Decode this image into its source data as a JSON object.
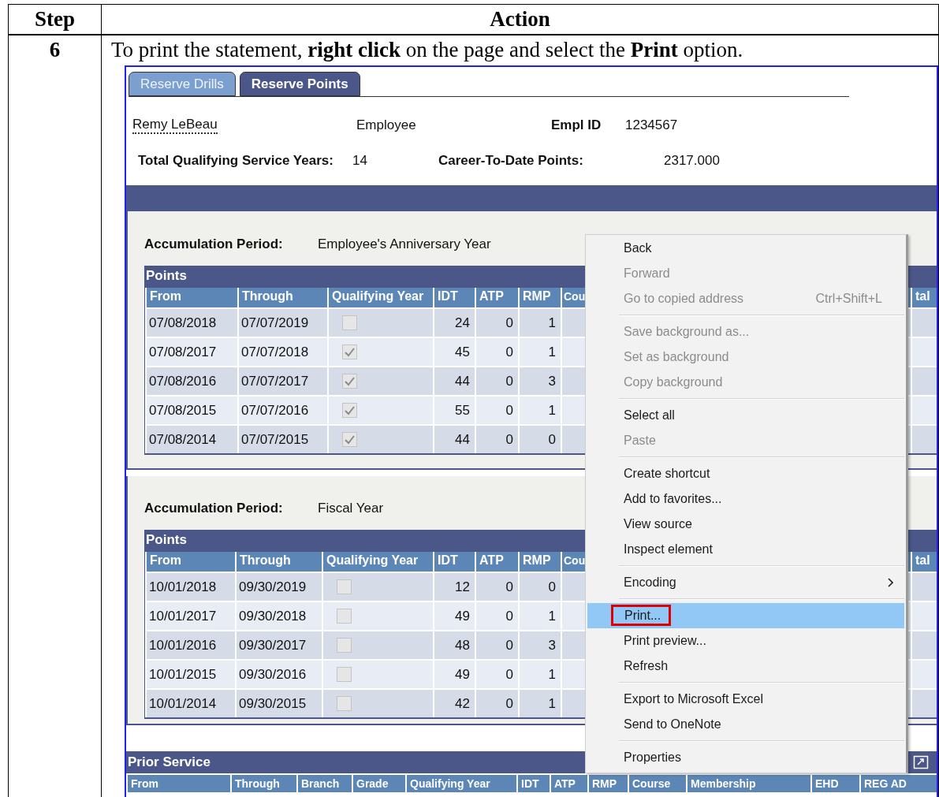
{
  "step_table": {
    "columns": [
      "Step",
      "Action"
    ],
    "step": "6",
    "instruction": "To print the statement, **right click** on the page and select the **Print** option."
  },
  "screenshot": {
    "tabs": [
      {
        "label": "Reserve Drills",
        "selected": false
      },
      {
        "label": "Reserve Points",
        "selected": true
      }
    ],
    "employee": {
      "name": "Remy LeBeau",
      "role": "Employee",
      "id_label": "Empl ID",
      "id": "1234567"
    },
    "totals": {
      "service_years_label": "Total Qualifying Service Years:",
      "service_years": "14",
      "points_label": "Career-To-Date Points:",
      "points": "2317.000"
    },
    "sections": [
      {
        "period_label": "Accumulation Period:",
        "period": "Employee's Anniversary Year",
        "title": "Points",
        "columns": [
          "From",
          "Through",
          "Qualifying Year",
          "IDT",
          "ATP",
          "RMP",
          "Cou",
          "tal"
        ],
        "rows": [
          {
            "from": "07/08/2018",
            "through": "07/07/2019",
            "qualifying": false,
            "idt": "24",
            "atp": "0",
            "rmp": "1"
          },
          {
            "from": "07/08/2017",
            "through": "07/07/2018",
            "qualifying": true,
            "idt": "45",
            "atp": "0",
            "rmp": "1"
          },
          {
            "from": "07/08/2016",
            "through": "07/07/2017",
            "qualifying": true,
            "idt": "44",
            "atp": "0",
            "rmp": "3"
          },
          {
            "from": "07/08/2015",
            "through": "07/07/2016",
            "qualifying": true,
            "idt": "55",
            "atp": "0",
            "rmp": "1"
          },
          {
            "from": "07/08/2014",
            "through": "07/07/2015",
            "qualifying": true,
            "idt": "44",
            "atp": "0",
            "rmp": "0"
          }
        ]
      },
      {
        "period_label": "Accumulation Period:",
        "period": "Fiscal Year",
        "title": "Points",
        "columns": [
          "From",
          "Through",
          "Qualifying Year",
          "IDT",
          "ATP",
          "RMP",
          "Cou",
          "tal"
        ],
        "rows": [
          {
            "from": "10/01/2018",
            "through": "09/30/2019",
            "qualifying": false,
            "idt": "12",
            "atp": "0",
            "rmp": "0"
          },
          {
            "from": "10/01/2017",
            "through": "09/30/2018",
            "qualifying": false,
            "idt": "49",
            "atp": "0",
            "rmp": "1"
          },
          {
            "from": "10/01/2016",
            "through": "09/30/2017",
            "qualifying": false,
            "idt": "48",
            "atp": "0",
            "rmp": "3"
          },
          {
            "from": "10/01/2015",
            "through": "09/30/2016",
            "qualifying": false,
            "idt": "49",
            "atp": "0",
            "rmp": "1"
          },
          {
            "from": "10/01/2014",
            "through": "09/30/2015",
            "qualifying": false,
            "idt": "42",
            "atp": "0",
            "rmp": "1"
          }
        ]
      }
    ],
    "prior_service": {
      "title": "Prior Service",
      "columns": [
        "From",
        "Through",
        "Branch",
        "Grade",
        "Qualifying Year",
        "IDT",
        "ATP",
        "RMP",
        "Course",
        "Membership",
        "EHD",
        "REG AD"
      ]
    },
    "context_menu": {
      "groups": [
        [
          {
            "label": "Back",
            "disabled": false,
            "selected": false,
            "outlined": false,
            "has_submenu": false
          },
          {
            "label": "Forward",
            "disabled": true,
            "selected": false,
            "outlined": false,
            "has_submenu": false
          },
          {
            "label": "Go to copied address",
            "shortcut": "Ctrl+Shift+L",
            "disabled": true,
            "selected": false,
            "outlined": false,
            "has_submenu": false
          }
        ],
        [
          {
            "label": "Save background as...",
            "disabled": true,
            "selected": false,
            "outlined": false,
            "has_submenu": false
          },
          {
            "label": "Set as background",
            "disabled": true,
            "selected": false,
            "outlined": false,
            "has_submenu": false
          },
          {
            "label": "Copy background",
            "disabled": true,
            "selected": false,
            "outlined": false,
            "has_submenu": false
          }
        ],
        [
          {
            "label": "Select all",
            "disabled": false,
            "selected": false,
            "outlined": false,
            "has_submenu": false
          },
          {
            "label": "Paste",
            "disabled": true,
            "selected": false,
            "outlined": false,
            "has_submenu": false
          }
        ],
        [
          {
            "label": "Create shortcut",
            "disabled": false,
            "selected": false,
            "outlined": false,
            "has_submenu": false
          },
          {
            "label": "Add to favorites...",
            "disabled": false,
            "selected": false,
            "outlined": false,
            "has_submenu": false
          },
          {
            "label": "View source",
            "disabled": false,
            "selected": false,
            "outlined": false,
            "has_submenu": false
          },
          {
            "label": "Inspect element",
            "disabled": false,
            "selected": false,
            "outlined": false,
            "has_submenu": false
          }
        ],
        [
          {
            "label": "Encoding",
            "disabled": false,
            "selected": false,
            "outlined": false,
            "has_submenu": true
          }
        ],
        [
          {
            "label": "Print...",
            "disabled": false,
            "selected": true,
            "outlined": true,
            "has_submenu": false
          },
          {
            "label": "Print preview...",
            "disabled": false,
            "selected": false,
            "outlined": false,
            "has_submenu": false
          },
          {
            "label": "Refresh",
            "disabled": false,
            "selected": false,
            "outlined": false,
            "has_submenu": false
          }
        ],
        [
          {
            "label": "Export to Microsoft Excel",
            "disabled": false,
            "selected": false,
            "outlined": false,
            "has_submenu": false
          },
          {
            "label": "Send to OneNote",
            "disabled": false,
            "selected": false,
            "outlined": false,
            "has_submenu": false
          }
        ],
        [
          {
            "label": "Properties",
            "disabled": false,
            "selected": false,
            "outlined": false,
            "has_submenu": false
          }
        ]
      ]
    }
  }
}
